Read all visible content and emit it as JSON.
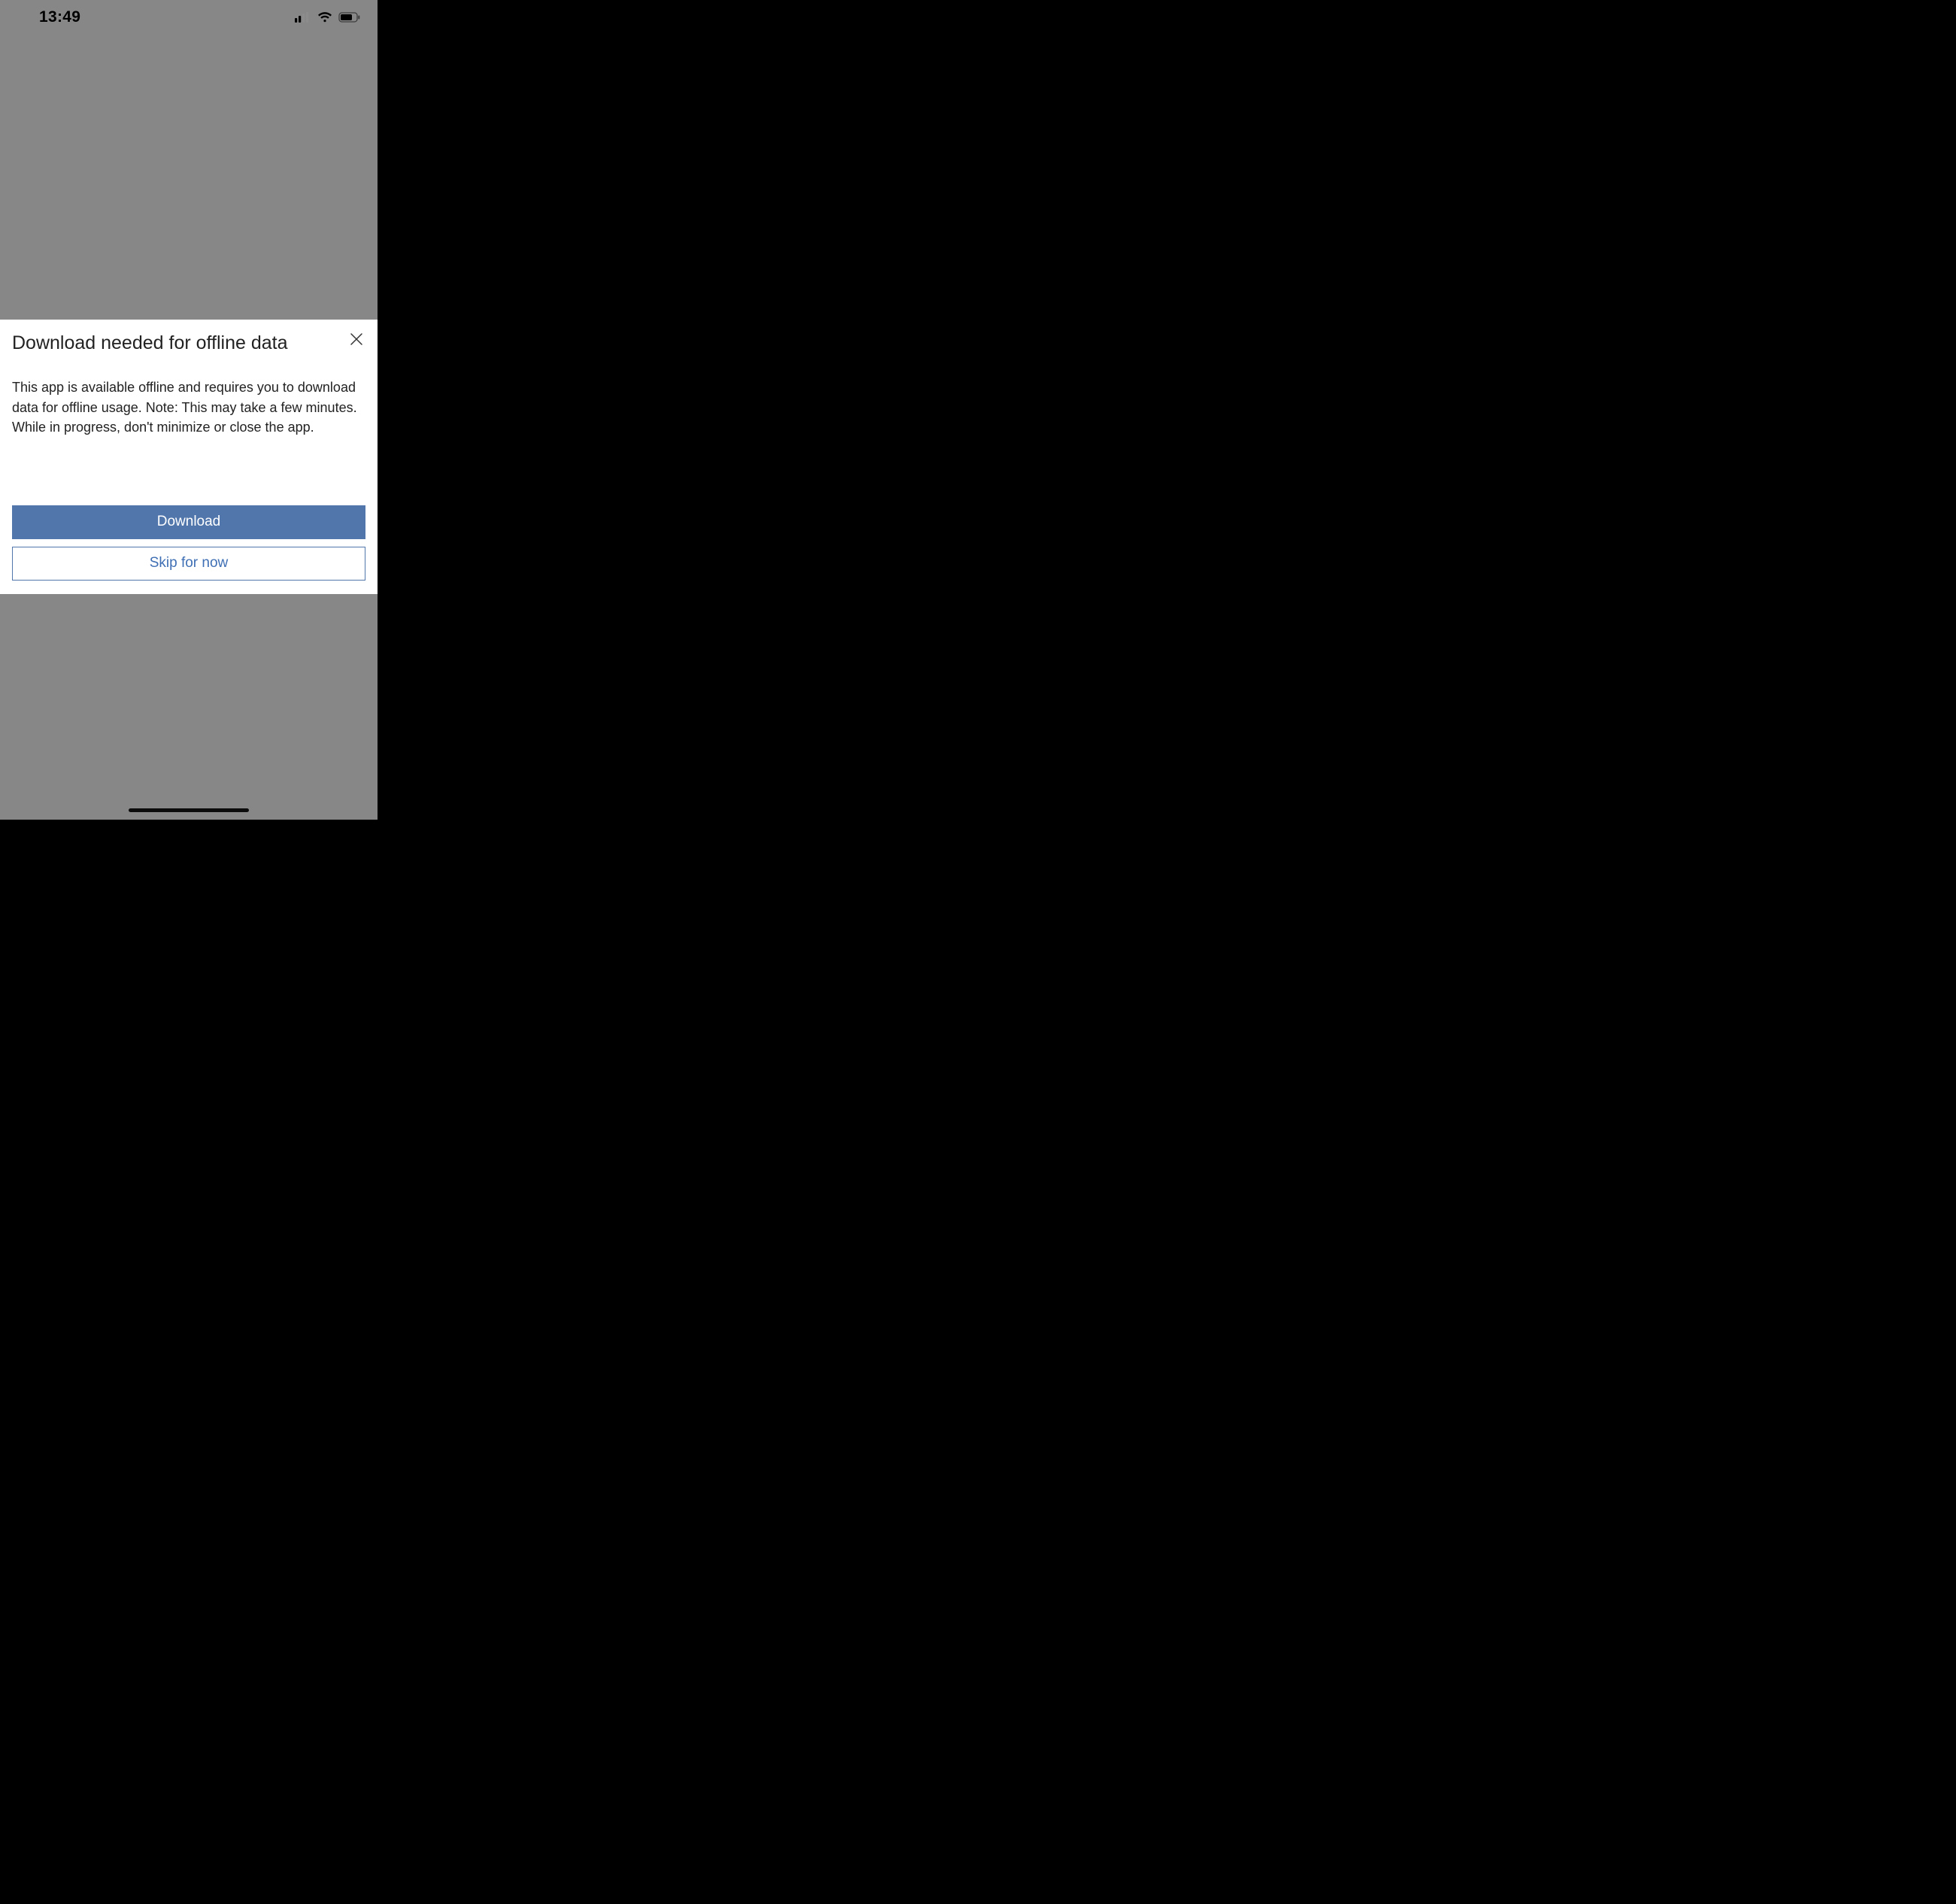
{
  "statusbar": {
    "time": "13:49"
  },
  "dialog": {
    "title": "Download needed for offline data",
    "body": "This app is available offline and requires you to download data for offline usage. Note: This may take a few minutes. While in progress, don't minimize or close the app.",
    "primary_label": "Download",
    "secondary_label": "Skip for now"
  }
}
